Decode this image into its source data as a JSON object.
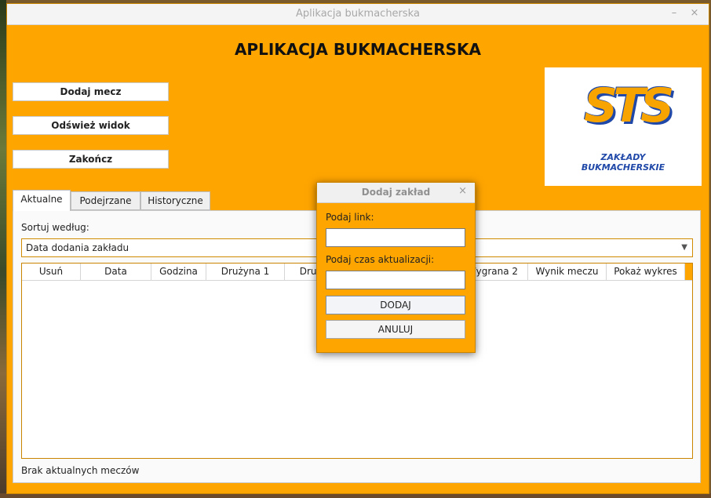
{
  "window": {
    "title": "Aplikacja bukmacherska",
    "minimize": "–",
    "close": "×"
  },
  "app_title": "APLIKACJA BUKMACHERSKA",
  "sidebar": {
    "buttons": [
      "Dodaj mecz",
      "Odśwież widok",
      "Zakończ"
    ]
  },
  "logo": {
    "brand": "STS",
    "line1": "ZAKŁADY",
    "line2": "BUKMACHERSKIE",
    "brand_color": "#f7a400",
    "text_color": "#1f48a8"
  },
  "tabs": [
    "Aktualne",
    "Podejrzane",
    "Historyczne"
  ],
  "active_tab": "Aktualne",
  "sort": {
    "label": "Sortuj według:",
    "selected": "Data dodania zakładu",
    "arrow": "▼"
  },
  "table": {
    "columns": [
      "Usuń",
      "Data",
      "Godzina",
      "Drużyna 1",
      "Drużyna 2",
      "",
      "Wygrana 2",
      "Wynik meczu",
      "Pokaż wykres"
    ]
  },
  "status": "Brak aktualnych meczów",
  "dialog": {
    "title": "Dodaj zakład",
    "close": "×",
    "link_label": "Podaj link:",
    "link_value": "",
    "time_label": "Podaj czas aktualizacji:",
    "time_value": "",
    "add_button": "DODAJ",
    "cancel_button": "ANULUJ"
  },
  "colors": {
    "accent": "#ffa500",
    "border": "#c98400"
  }
}
